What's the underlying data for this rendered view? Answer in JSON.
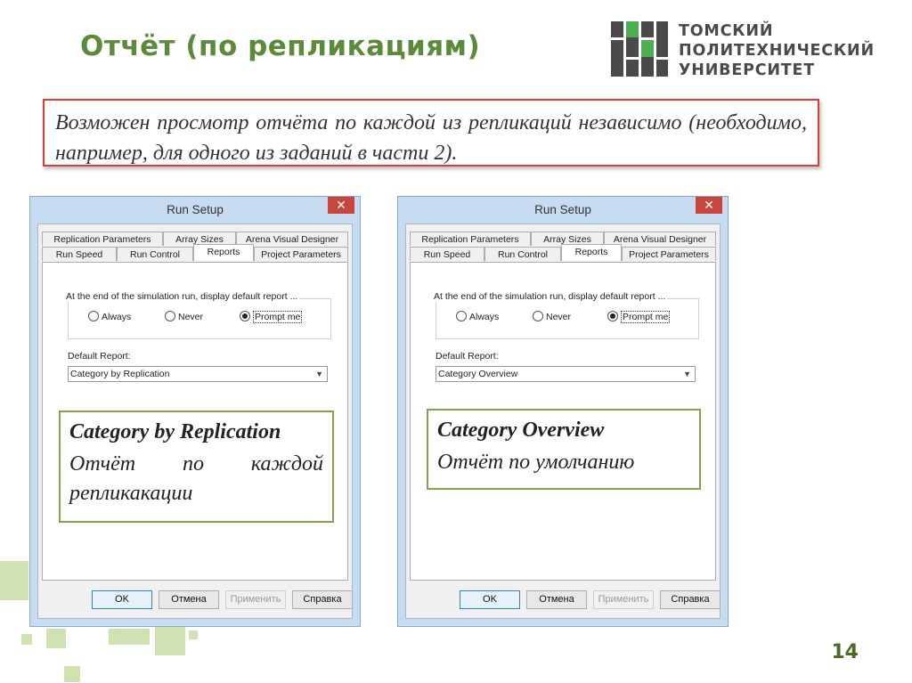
{
  "slide": {
    "title": "Отчёт (по репликациям)",
    "page_number": "14",
    "note": "Возможен просмотр отчёта по каждой из репликаций независимо (необходимо, например, для одного из заданий в части 2).",
    "accent_color": "#5d8a3a",
    "note_border_color": "#e53935",
    "callout_border_color": "#7da84a"
  },
  "logo": {
    "lines": [
      "ТОМСКИЙ",
      "ПОЛИТЕХНИЧЕСКИЙ",
      "УНИВЕРСИТЕТ"
    ]
  },
  "dialogs": [
    {
      "title": "Run Setup",
      "close_icon": "close-icon",
      "tabs_row1": [
        "Replication Parameters",
        "Array Sizes",
        "Arena Visual Designer"
      ],
      "tabs_row2": [
        "Run Speed",
        "Run Control",
        "Reports",
        "Project Parameters"
      ],
      "active_tab": "Reports",
      "group_label": "At the end of the simulation run, display default report ...",
      "options": [
        "Always",
        "Never",
        "Prompt me"
      ],
      "selected_option": "Prompt me",
      "default_report_label": "Default Report:",
      "default_report_value": "Category by Replication",
      "buttons": [
        "OK",
        "Отмена",
        "Применить",
        "Справка"
      ],
      "callout_title": "Category by Replication",
      "callout_desc": "Отчёт по каждой репликакации"
    },
    {
      "title": "Run Setup",
      "close_icon": "close-icon",
      "tabs_row1": [
        "Replication Parameters",
        "Array Sizes",
        "Arena Visual Designer"
      ],
      "tabs_row2": [
        "Run Speed",
        "Run Control",
        "Reports",
        "Project Parameters"
      ],
      "active_tab": "Reports",
      "group_label": "At the end of the simulation run, display default report ...",
      "options": [
        "Always",
        "Never",
        "Prompt me"
      ],
      "selected_option": "Prompt me",
      "default_report_label": "Default Report:",
      "default_report_value": "Category Overview",
      "buttons": [
        "OK",
        "Отмена",
        "Применить",
        "Справка"
      ],
      "callout_title": "Category Overview",
      "callout_desc": "Отчёт по умолчанию"
    }
  ]
}
